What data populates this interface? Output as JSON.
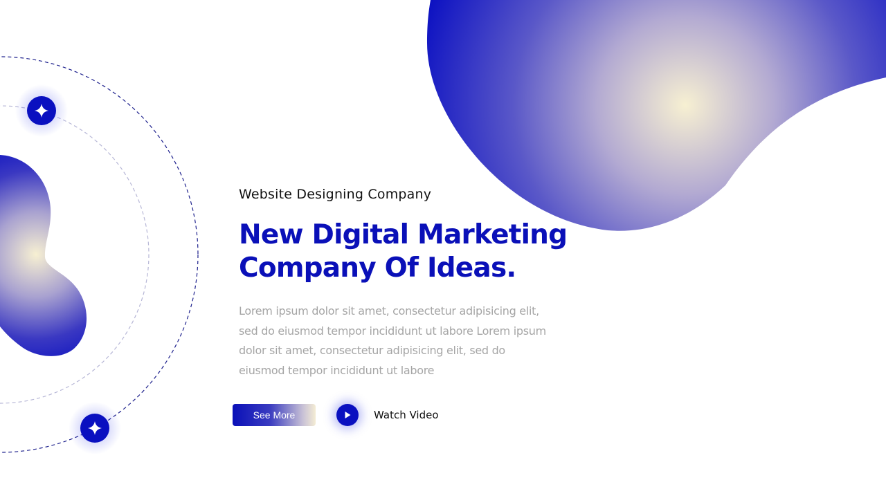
{
  "slide": {
    "subtitle": "Website Designing Company",
    "headline": {
      "line1": "New Digital Marketing",
      "line2": "Company Of Ideas."
    },
    "body": {
      "line1": "Lorem ipsum dolor sit amet, consectetur adipisicing elit,",
      "line2": "sed do eiusmod tempor incididunt ut labore Lorem ipsum",
      "line3": "dolor sit amet, consectetur adipisicing elit, sed do",
      "line4": "eiusmod tempor incididunt ut labore"
    },
    "buttons": {
      "see_more": "See More",
      "watch_video": "Watch Video"
    }
  },
  "icons": {
    "star_badge_top": "sparkle-icon",
    "star_badge_bottom": "sparkle-icon",
    "play": "play-icon"
  },
  "colors": {
    "brand_blue": "#0a10b8",
    "heading": "#0a10b8",
    "body_text": "#a5a5a5",
    "gradient_light": "#f7f0d2"
  }
}
